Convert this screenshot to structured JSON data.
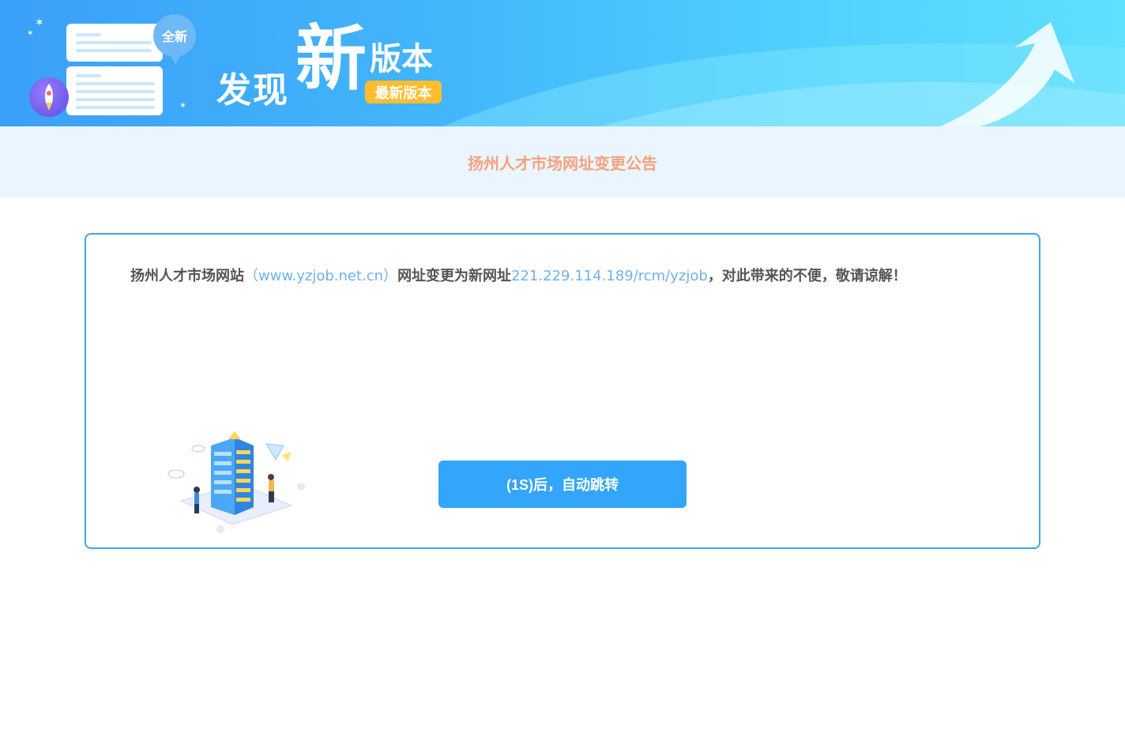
{
  "banner": {
    "bubble_label": "全新",
    "title_discover": "发现",
    "title_new": "新",
    "title_version": "版本",
    "tag_latest": "最新版本"
  },
  "announcement": {
    "title": "扬州人才市场网址变更公告"
  },
  "notice": {
    "prefix": "扬州人才市场网站",
    "old_url": "（www.yzjob.net.cn）",
    "middle": "网址变更为新网址",
    "new_url": "221.229.114.189/rcm/yzjob",
    "suffix": "，对此带来的不便，敬请谅解！"
  },
  "redirect_button": {
    "label": "(1S)后，自动跳转"
  },
  "colors": {
    "banner_start": "#3aa0f8",
    "banner_end": "#5fe0ff",
    "title_color": "#f5a27e",
    "link_color": "#6fb2ec",
    "button_bg": "#33a6fb",
    "border_color": "#3da8e6"
  }
}
